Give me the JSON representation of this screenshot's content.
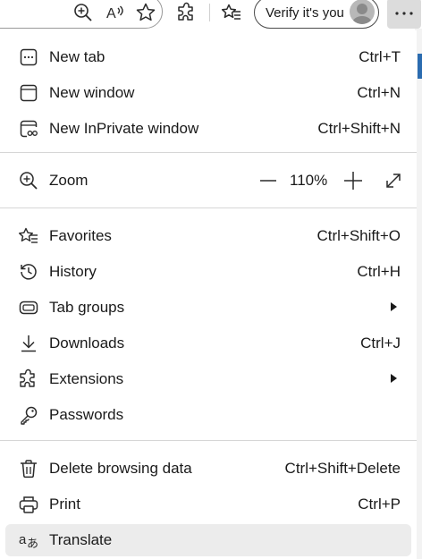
{
  "toolbar": {
    "icons": [
      "zoom-icon",
      "read-aloud-icon",
      "favorite-star-icon",
      "extensions-icon",
      "favorites-icon"
    ],
    "profile_label": "Verify it's you",
    "more_icon": "more-options-icon"
  },
  "menu": {
    "groups": [
      [
        {
          "label": "New tab",
          "shortcut": "Ctrl+T",
          "icon": "new-tab-icon"
        },
        {
          "label": "New window",
          "shortcut": "Ctrl+N",
          "icon": "new-window-icon"
        },
        {
          "label": "New InPrivate window",
          "shortcut": "Ctrl+Shift+N",
          "icon": "inprivate-icon"
        }
      ],
      [
        {
          "label": "Favorites",
          "shortcut": "Ctrl+Shift+O",
          "icon": "favorites-icon"
        },
        {
          "label": "History",
          "shortcut": "Ctrl+H",
          "icon": "history-icon"
        },
        {
          "label": "Tab groups",
          "shortcut": "",
          "icon": "tab-groups-icon",
          "submenu": true
        },
        {
          "label": "Downloads",
          "shortcut": "Ctrl+J",
          "icon": "downloads-icon"
        },
        {
          "label": "Extensions",
          "shortcut": "",
          "icon": "extensions-icon",
          "submenu": true
        },
        {
          "label": "Passwords",
          "shortcut": "",
          "icon": "key-icon"
        }
      ],
      [
        {
          "label": "Delete browsing data",
          "shortcut": "Ctrl+Shift+Delete",
          "icon": "trash-icon"
        },
        {
          "label": "Print",
          "shortcut": "Ctrl+P",
          "icon": "printer-icon"
        },
        {
          "label": "Translate",
          "shortcut": "",
          "icon": "translate-icon",
          "highlighted": true
        }
      ]
    ],
    "zoom": {
      "label": "Zoom",
      "value": "110%",
      "minus_symbol": "—",
      "plus_symbol": "+",
      "icon": "zoom-icon"
    }
  },
  "colors": {
    "highlight": "#ececec",
    "separator": "#d6d6d6",
    "more_button_bg": "#dcdcdc"
  }
}
